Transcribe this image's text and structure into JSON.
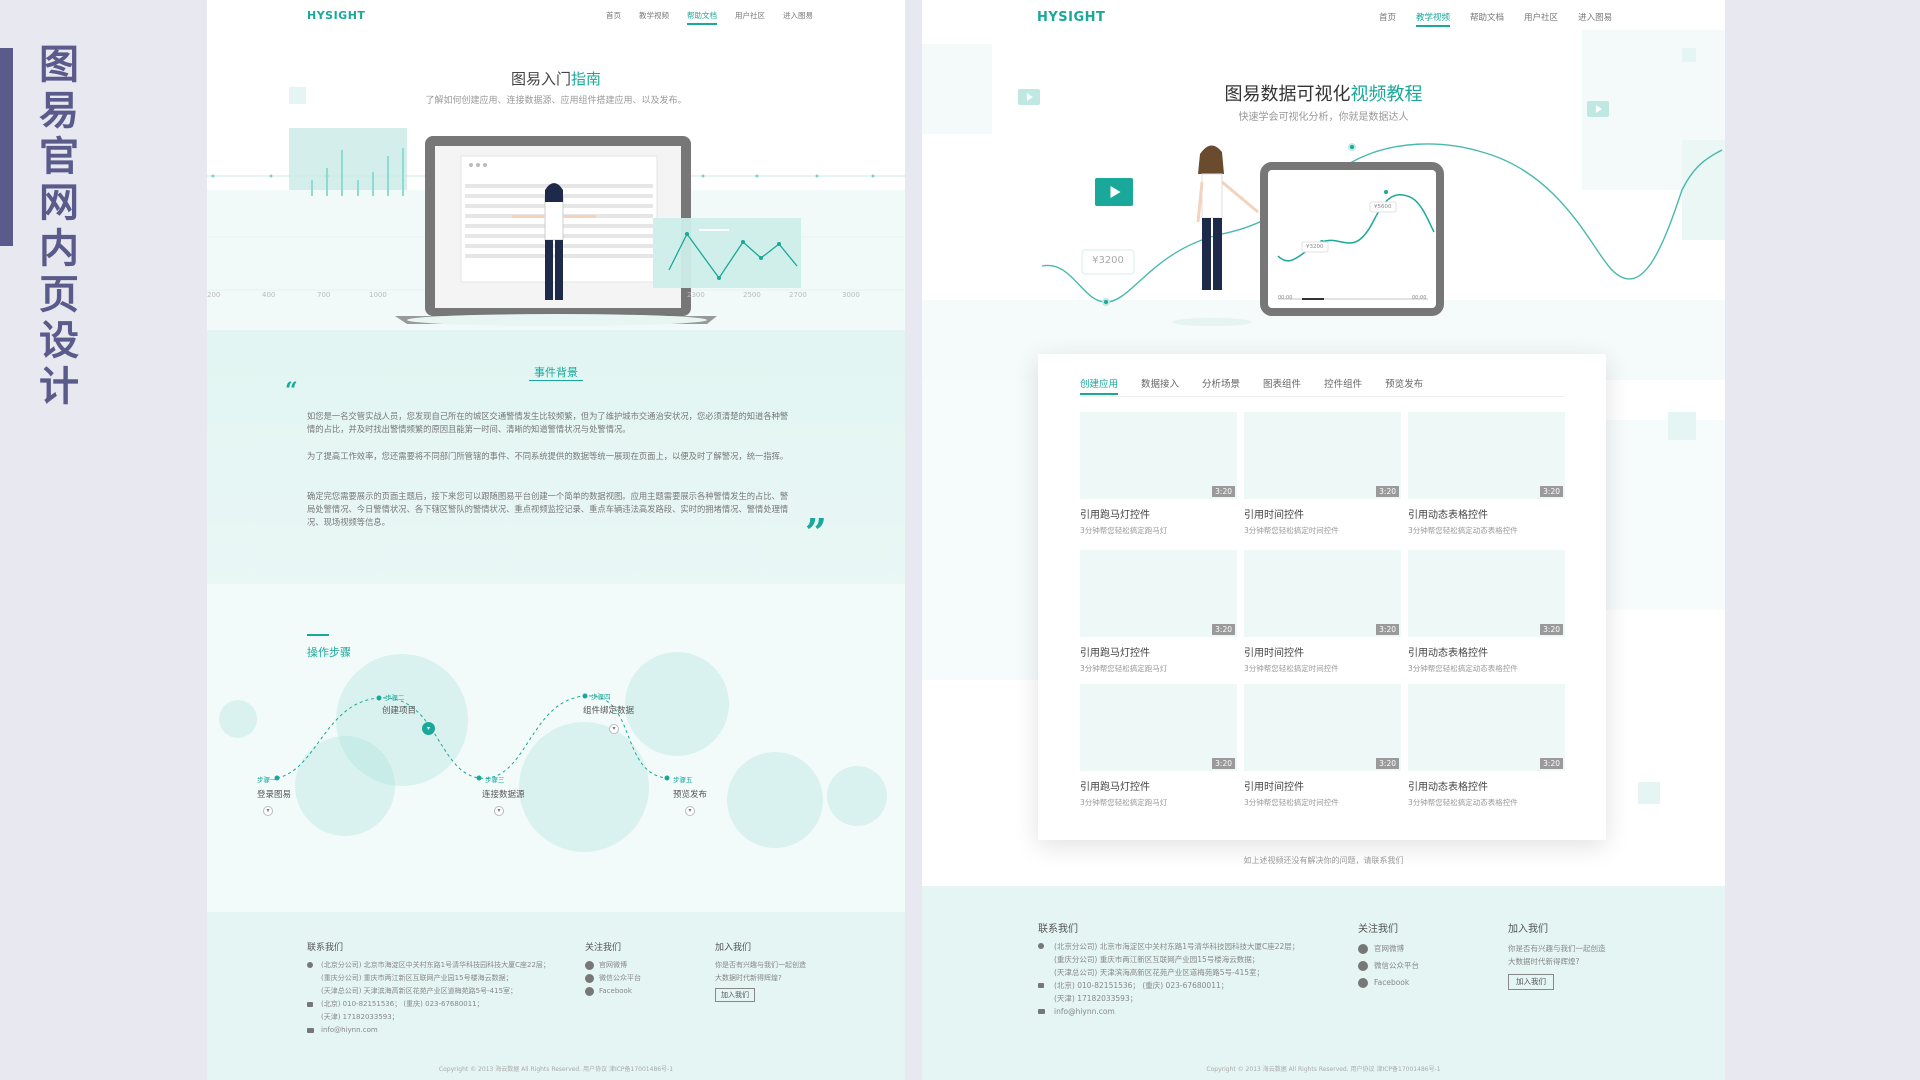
{
  "side_title": [
    "图",
    "易",
    "官",
    "网",
    "内",
    "页",
    "设",
    "计"
  ],
  "left": {
    "logo": "HYSIGHT",
    "nav": [
      {
        "label": "首页",
        "active": false
      },
      {
        "label": "教学视频",
        "active": false
      },
      {
        "label": "帮助文档",
        "active": true
      },
      {
        "label": "用户社区",
        "active": false
      },
      {
        "label": "进入图易",
        "active": false
      }
    ],
    "hero_title_a": "图易入门",
    "hero_title_b": "指南",
    "hero_subtitle": "了解如何创建应用、连接数据源、应用组件搭建应用、以及发布。",
    "axis_labels": [
      "200",
      "400",
      "700",
      "1000",
      "2300",
      "2500",
      "2700",
      "3000"
    ],
    "background": {
      "title": "事件背景",
      "paragraphs": [
        "如您是一名交管实战人员，您发现自己所在的城区交通警情发生比较频繁，但为了维护城市交通治安状况，您必须清楚的知道各种警情的占比，并及时找出警情频繁的原因且能第一时间、清晰的知道警情状况与处警情况。",
        "为了提高工作效率，您还需要将不同部门所管辖的事件、不同系统提供的数据等统一展现在页面上，以便及时了解警况，统一指挥。",
        "确定完您需要展示的页面主题后，接下来您可以跟随图易平台创建一个简单的数据视图。应用主题需要展示各种警情发生的占比、警局处警情况、今日警情状况、各下辖区警队的警情状况、重点视频监控记录、重点车辆违法高发路段、实时的拥堵情况、警情处理情况、现场视频等信息。"
      ]
    },
    "steps": {
      "title": "操作步骤",
      "items": [
        {
          "tag": "步骤一",
          "label": "登录图易"
        },
        {
          "tag": "步骤二",
          "label": "创建项目"
        },
        {
          "tag": "步骤三",
          "label": "连接数据源"
        },
        {
          "tag": "步骤四",
          "label": "组件绑定数据"
        },
        {
          "tag": "步骤五",
          "label": "预览发布"
        }
      ]
    },
    "footer": {
      "contact_title": "联系我们",
      "addresses": [
        "(北京分公司)  北京市海淀区中关村东路1号清华科技园科技大厦C座22层；",
        "(重庆分公司)  重庆市两江新区互联网产业园15号楼海云数据；",
        "(天津总公司)  天津滨海高新区花苑产业区道梅苑路5号-415室；"
      ],
      "phones": [
        "(北京)  010-82151536；  (重庆)  023-67680011；",
        "(天津)  17182033593；"
      ],
      "email": "info@hiynn.com",
      "follow_title": "关注我们",
      "follow_items": [
        "官网微博",
        "微信公众平台",
        "Facebook"
      ],
      "join_title": "加入我们",
      "join_text": [
        "你是否有兴趣与我们一起创造",
        "大数据时代新得辉煌?"
      ],
      "join_button": "加入我们",
      "copyright": "Copyright © 2013 海云数据 All Rights Reserved. 用户协议 津ICP备17001486号-1"
    }
  },
  "right": {
    "logo": "HYSIGHT",
    "nav": [
      {
        "label": "首页",
        "active": false
      },
      {
        "label": "教学视频",
        "active": true
      },
      {
        "label": "帮助文档",
        "active": false
      },
      {
        "label": "用户社区",
        "active": false
      },
      {
        "label": "进入图易",
        "active": false
      }
    ],
    "hero_title_a": "图易数据可视化",
    "hero_title_b": "视频教程",
    "hero_subtitle": "快速学会可视化分析，你就是数据达人",
    "price_tag_big": "¥3200",
    "screen_tag_1": "¥3200",
    "screen_tag_2": "¥5600",
    "player_time_start": "00:00",
    "player_time_end": "00:00",
    "tabs": [
      {
        "label": "创建应用",
        "active": true
      },
      {
        "label": "数据接入",
        "active": false
      },
      {
        "label": "分析场景",
        "active": false
      },
      {
        "label": "图表组件",
        "active": false
      },
      {
        "label": "控件组件",
        "active": false
      },
      {
        "label": "预览发布",
        "active": false
      }
    ],
    "videos": [
      {
        "title": "引用跑马灯控件",
        "sub": "3分钟帮您轻松搞定跑马灯",
        "duration": "3:20"
      },
      {
        "title": "引用时间控件",
        "sub": "3分钟帮您轻松搞定时间控件",
        "duration": "3:20"
      },
      {
        "title": "引用动态表格控件",
        "sub": "3分钟帮您轻松搞定动态表格控件",
        "duration": "3:20"
      },
      {
        "title": "引用跑马灯控件",
        "sub": "3分钟帮您轻松搞定跑马灯",
        "duration": "3:20"
      },
      {
        "title": "引用时间控件",
        "sub": "3分钟帮您轻松搞定时间控件",
        "duration": "3:20"
      },
      {
        "title": "引用动态表格控件",
        "sub": "3分钟帮您轻松搞定动态表格控件",
        "duration": "3:20"
      },
      {
        "title": "引用跑马灯控件",
        "sub": "3分钟帮您轻松搞定跑马灯",
        "duration": "3:20"
      },
      {
        "title": "引用时间控件",
        "sub": "3分钟帮您轻松搞定时间控件",
        "duration": "3:20"
      },
      {
        "title": "引用动态表格控件",
        "sub": "3分钟帮您轻松搞定动态表格控件",
        "duration": "3:20"
      }
    ],
    "contact_line": "如上述视频还没有解决你的问题，请联系我们",
    "footer": {
      "contact_title": "联系我们",
      "addresses": [
        "(北京分公司)  北京市海淀区中关村东路1号清华科技园科技大厦C座22层；",
        "(重庆分公司)  重庆市两江新区互联网产业园15号楼海云数据；",
        "(天津总公司)  天津滨海高新区花苑产业区道梅苑路5号-415室；"
      ],
      "phones": [
        "(北京)  010-82151536；  (重庆)  023-67680011；",
        "(天津)  17182033593；"
      ],
      "email": "info@hiynn.com",
      "follow_title": "关注我们",
      "follow_items": [
        "官网微博",
        "微信公众平台",
        "Facebook"
      ],
      "join_title": "加入我们",
      "join_text": [
        "你是否有兴趣与我们一起创造",
        "大数据时代新得辉煌?"
      ],
      "join_button": "加入我们",
      "copyright": "Copyright © 2013 海云数据 All Rights Reserved. 用户协议 津ICP备17001486号-1"
    }
  },
  "colors": {
    "accent": "#1aa89a",
    "side_title": "#5a5b8a",
    "light_teal": "#e4f5f3"
  }
}
